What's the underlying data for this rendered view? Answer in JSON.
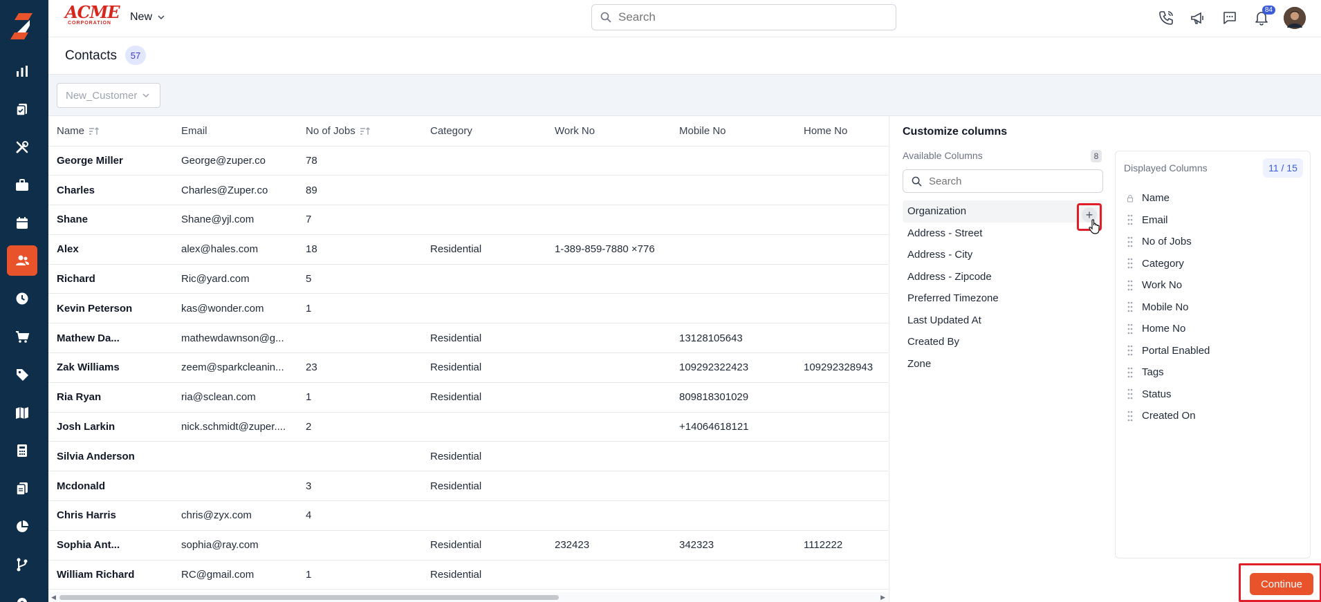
{
  "header": {
    "brand": "ACME",
    "brand_sub": "CORPORATION",
    "new_label": "New",
    "search_placeholder": "Search",
    "notification_count": "84"
  },
  "page": {
    "title": "Contacts",
    "count": "57",
    "view_filter": "New_Customer"
  },
  "table": {
    "columns": [
      "Name",
      "Email",
      "No of Jobs",
      "Category",
      "Work No",
      "Mobile No",
      "Home No"
    ],
    "rows": [
      [
        "George Miller",
        "George@zuper.co",
        "78",
        "",
        "",
        "",
        ""
      ],
      [
        "Charles",
        "Charles@Zuper.co",
        "89",
        "",
        "",
        "",
        ""
      ],
      [
        "Shane",
        "Shane@yjl.com",
        "7",
        "",
        "",
        "",
        ""
      ],
      [
        "Alex",
        "alex@hales.com",
        "18",
        "Residential",
        "1-389-859-7880 ×776",
        "",
        ""
      ],
      [
        "Richard",
        "Ric@yard.com",
        "5",
        "",
        "",
        "",
        ""
      ],
      [
        "Kevin Peterson",
        "kas@wonder.com",
        "1",
        "",
        "",
        "",
        ""
      ],
      [
        "Mathew Da...",
        "mathewdawnson@g...",
        "",
        "Residential",
        "",
        "13128105643",
        ""
      ],
      [
        "Zak Williams",
        "zeem@sparkcleanin...",
        "23",
        "Residential",
        "",
        "109292322423",
        "109292328943"
      ],
      [
        "Ria Ryan",
        "ria@sclean.com",
        "1",
        "Residential",
        "",
        "809818301029",
        ""
      ],
      [
        "Josh Larkin",
        "nick.schmidt@zuper....",
        "2",
        "",
        "",
        "+14064618121",
        ""
      ],
      [
        "Silvia Anderson",
        "",
        "",
        "Residential",
        "",
        "",
        ""
      ],
      [
        "Mcdonald",
        "",
        "3",
        "Residential",
        "",
        "",
        ""
      ],
      [
        "Chris Harris",
        "chris@zyx.com",
        "4",
        "",
        "",
        "",
        ""
      ],
      [
        "Sophia Ant...",
        "sophia@ray.com",
        "",
        "Residential",
        "232423",
        "342323",
        "1112222"
      ],
      [
        "William Richard",
        "RC@gmail.com",
        "1",
        "Residential",
        "",
        "",
        ""
      ]
    ]
  },
  "customize": {
    "title": "Customize columns",
    "available_label": "Available Columns",
    "available_count": "8",
    "search_placeholder": "Search",
    "available": [
      "Organization",
      "Address - Street",
      "Address - City",
      "Address - Zipcode",
      "Preferred Timezone",
      "Last Updated At",
      "Created By",
      "Zone"
    ],
    "displayed_label": "Displayed Columns",
    "displayed_count": "11 / 15",
    "displayed": [
      "Name",
      "Email",
      "No of Jobs",
      "Category",
      "Work No",
      "Mobile No",
      "Home No",
      "Portal Enabled",
      "Tags",
      "Status",
      "Created On"
    ],
    "continue_label": "Continue"
  },
  "colors": {
    "sidebar_bg": "#0f2e4a",
    "accent": "#e8532b",
    "highlight_box": "#e11d2a"
  },
  "sidebar_icons": [
    "dashboard-icon",
    "quotes-icon",
    "tools-icon",
    "jobs-icon",
    "calendar-icon",
    "contacts-icon",
    "timesheet-icon",
    "cart-icon",
    "tag-icon",
    "map-icon",
    "invoice-icon",
    "documents-icon",
    "reports-icon",
    "workflow-icon",
    "settings-icon"
  ]
}
